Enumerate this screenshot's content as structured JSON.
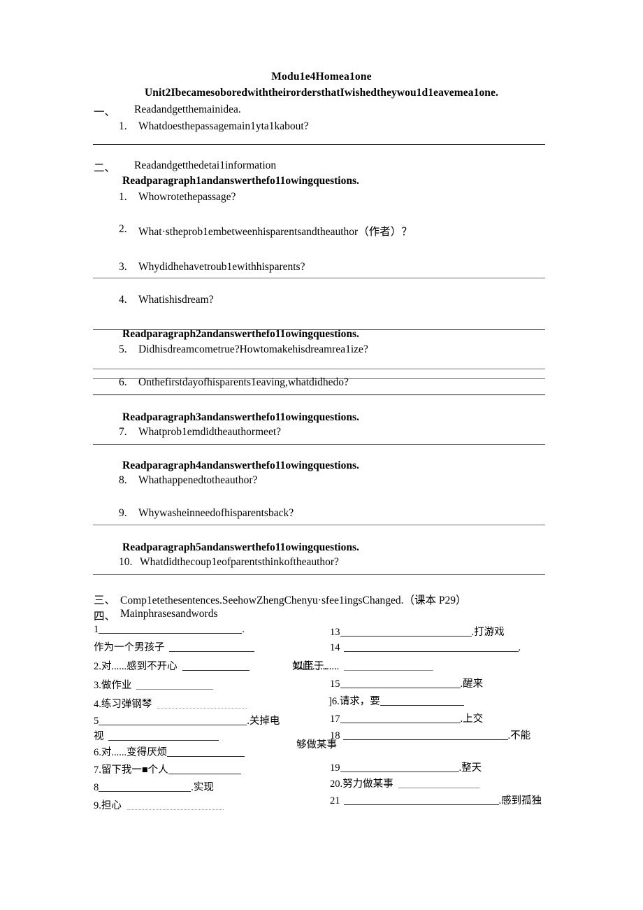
{
  "document": {
    "title_line1": "Modu1e4Homea1one",
    "title_line2": "Unit2IbecamesoboredwiththeirordersthatIwishedtheywou1d1eavemea1one."
  },
  "sections": {
    "one": {
      "marker": "一、",
      "heading": "Readandgetthemainidea.",
      "q1_num": "1.",
      "q1_text": "Whatdoesthepassagemain1yta1kabout?"
    },
    "two": {
      "marker": "二、",
      "heading": "Readandgetthedetai1information",
      "para1_head": "Readparagraph1andanswerthefo11owingquestions.",
      "para2_head": "Readparagraph2andanswerthefo11owingquestions.",
      "para3_head": "Readparagraph3andanswerthefo11owingquestions.",
      "para4_head": "Readparagraph4andanswerthefo11owingquestions.",
      "para5_head": "Readparagraph5andanswerthefo11owingquestions.",
      "questions": [
        {
          "num": "1.",
          "text": "Whowrotethepassage?"
        },
        {
          "num": "2.",
          "text": "What·stheprob1embetweenhisparentsandtheauthor（作者）？"
        },
        {
          "num": "3.",
          "text": "Whydidhehavetroub1ewithhisparents?"
        },
        {
          "num": "4.",
          "text": "Whatishisdream?"
        },
        {
          "num": "5.",
          "text": "Didhisdreamcometrue?Howtomakehisdreamrea1ize?"
        },
        {
          "num": "6.",
          "text": "Onthefirstdayofhisparents1eaving,whatdidhedo?"
        },
        {
          "num": "7.",
          "text": "Whatprob1emdidtheauthormeet?"
        },
        {
          "num": "8.",
          "text": "Whathappenedtotheauthor?"
        },
        {
          "num": "9.",
          "text": "Whywasheinneedofhisparentsback?"
        },
        {
          "num": "10.",
          "text": "Whatdidthecoup1eofparentsthinkoftheauthor?"
        }
      ]
    },
    "three": {
      "marker": "三、",
      "text": "Comp1etethesentences.SeehowZhengChenyu·sfee1ingsChanged.（课本 P29）"
    },
    "four": {
      "marker": "四、",
      "text": "Mainphrasesandwords"
    }
  },
  "phrases": {
    "left": [
      {
        "num": "1",
        "before": "",
        "after": "."
      },
      {
        "num": "",
        "before": "作为一个男孩子",
        "after": ""
      },
      {
        "num": "2.",
        "before": "对......感到不开心",
        "after": ""
      },
      {
        "num": "3.",
        "before": "做作业",
        "after": ""
      },
      {
        "num": "4.",
        "before": "练习弹钢琴",
        "after": ""
      },
      {
        "num": "5",
        "before": "",
        "after": ".关掉电"
      },
      {
        "num": "",
        "before": "视",
        "after": ""
      },
      {
        "num": "6.",
        "before": "对......变得厌烦",
        "after": ""
      },
      {
        "num": "7.",
        "before": "留下我一■个人",
        "after": ""
      },
      {
        "num": "8",
        "before": "",
        "after": ".实现"
      },
      {
        "num": "9.",
        "before": "担心",
        "after": ""
      }
    ],
    "right": [
      {
        "num": "13",
        "before": "",
        "after": ".打游戏"
      },
      {
        "num": "14",
        "before": "",
        "after": "."
      },
      {
        "num": "",
        "before": "以至于......",
        "after": ""
      },
      {
        "num": "15",
        "before": "",
        "after": ".醒来"
      },
      {
        "num": "]6.",
        "before": "请求，要",
        "after": ""
      },
      {
        "num": "17",
        "before": "",
        "after": ".上交"
      },
      {
        "num": "18",
        "before": "",
        "after": ".不能"
      },
      {
        "num": "19",
        "before": "",
        "after": ".整天"
      },
      {
        "num": "20.",
        "before": "努力做某事",
        "after": ""
      },
      {
        "num": "21",
        "before": "",
        "after": ".感到孤独"
      }
    ],
    "overflow": {
      "so_that": "如此......",
      "enough_to": "够做某事"
    }
  }
}
